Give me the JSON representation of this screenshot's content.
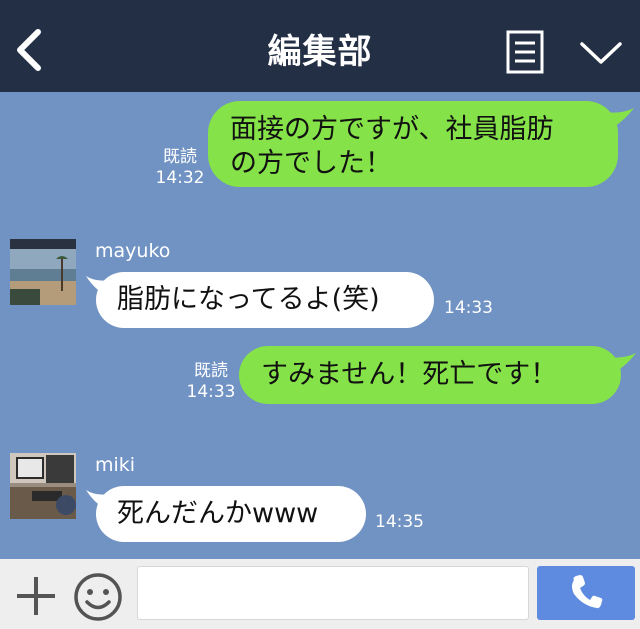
{
  "header": {
    "title": "編集部",
    "back_icon": "chevron-left-icon",
    "notes_icon": "note-icon",
    "menu_icon": "chevron-down-icon"
  },
  "messages": [
    {
      "side": "out",
      "text_lines": [
        "面接の方ですが、社員脂肪",
        "の方でした！"
      ],
      "read_label": "既読",
      "time": "14:32"
    },
    {
      "side": "in",
      "sender": "mayuko",
      "text": "脂肪になってるよ(笑)",
      "time": "14:33",
      "avatar": "beach-photo-avatar"
    },
    {
      "side": "out",
      "text": "すみません！死亡です！",
      "read_label": "既読",
      "time": "14:33"
    },
    {
      "side": "in",
      "sender": "miki",
      "text": "死んだんかwww",
      "time": "14:35",
      "avatar": "office-photo-avatar"
    }
  ],
  "input_bar": {
    "plus_icon": "plus-icon",
    "emoji_icon": "smiley-icon",
    "message_value": "",
    "call_icon": "phone-icon"
  },
  "colors": {
    "header_bg": "#232f44",
    "chat_bg": "#7193c4",
    "outgoing_bubble": "#85e249",
    "incoming_bubble": "#ffffff",
    "call_button": "#5e8ae0"
  }
}
